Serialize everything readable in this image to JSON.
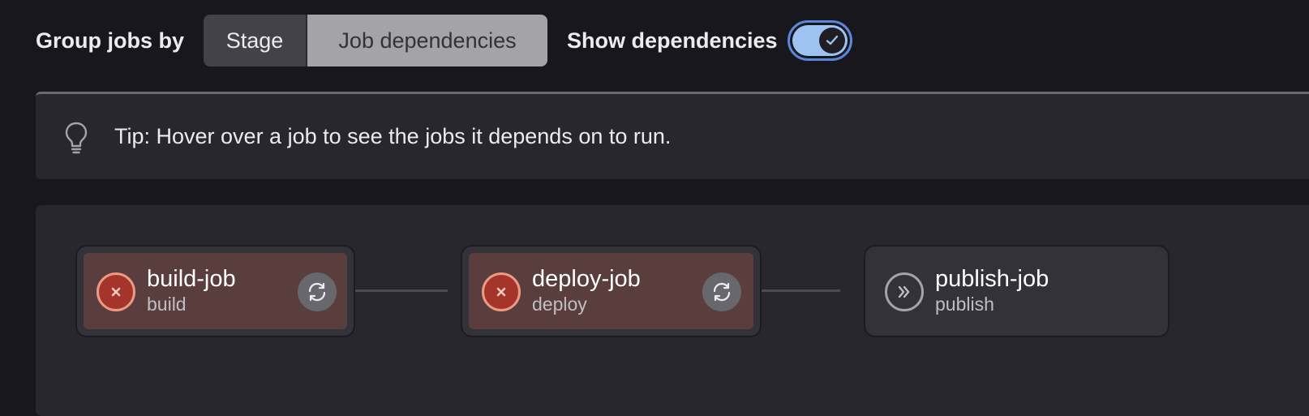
{
  "toolbar": {
    "group_label": "Group jobs by",
    "segments": [
      {
        "label": "Stage",
        "selected": false
      },
      {
        "label": "Job dependencies",
        "selected": true
      }
    ],
    "show_deps_label": "Show dependencies",
    "show_deps_on": true
  },
  "tip": {
    "icon": "lightbulb-icon",
    "text": "Tip: Hover over a job to see the jobs it depends on to run."
  },
  "jobs": [
    {
      "name": "build-job",
      "stage": "build",
      "status": "failed",
      "status_icon": "failed-x-icon",
      "action_icon": "retry-icon"
    },
    {
      "name": "deploy-job",
      "stage": "deploy",
      "status": "failed",
      "status_icon": "failed-x-icon",
      "action_icon": "retry-icon"
    },
    {
      "name": "publish-job",
      "stage": "publish",
      "status": "skipped",
      "status_icon": "skipped-chevrons-icon"
    }
  ],
  "colors": {
    "background": "#18171d",
    "panel": "#28272d",
    "failed_fill": "#a5352b",
    "failed_ring": "#ec9a84",
    "failed_card": "#5a3e3e",
    "toggle_on": "#9dc3f2",
    "toggle_border": "#5a87d8"
  }
}
